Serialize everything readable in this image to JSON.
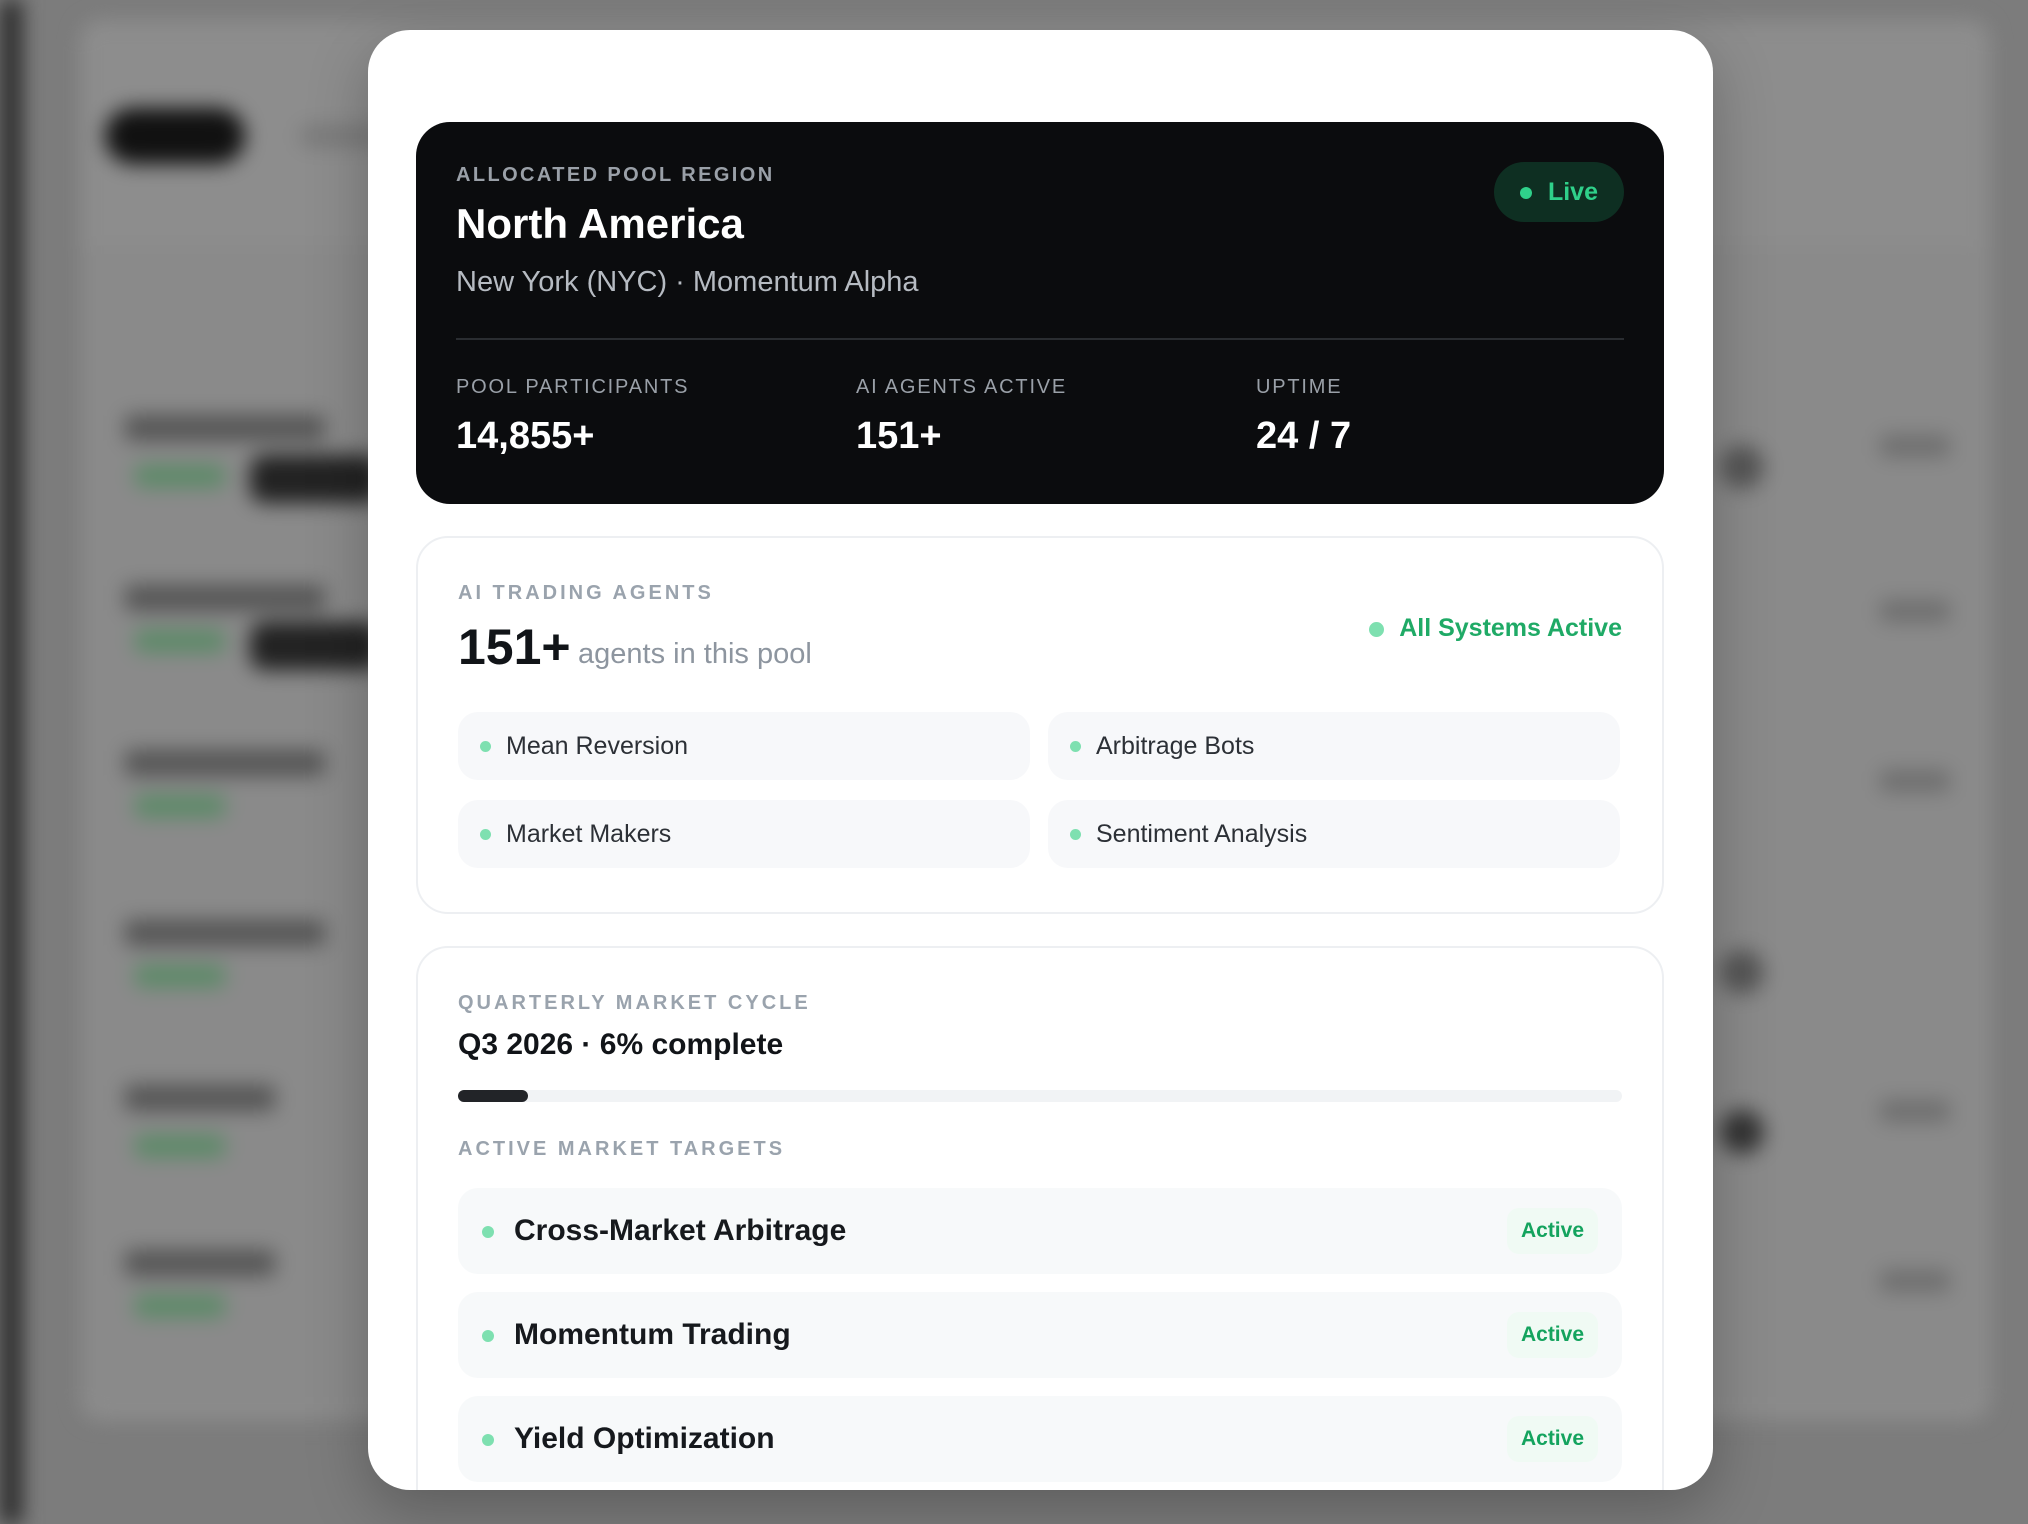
{
  "region": {
    "eyebrow": "ALLOCATED POOL REGION",
    "title": "North America",
    "subtitle": "New York (NYC) · Momentum Alpha",
    "live_label": "Live",
    "stats": [
      {
        "label": "POOL PARTICIPANTS",
        "value": "14,855+"
      },
      {
        "label": "AI AGENTS ACTIVE",
        "value": "151+"
      },
      {
        "label": "UPTIME",
        "value": "24 / 7"
      }
    ]
  },
  "agents": {
    "eyebrow": "AI TRADING AGENTS",
    "count": "151+",
    "count_suffix": "agents in this pool",
    "status": "All Systems Active",
    "types": [
      "Mean Reversion",
      "Arbitrage Bots",
      "Market Makers",
      "Sentiment Analysis"
    ]
  },
  "cycle": {
    "eyebrow": "QUARTERLY MARKET CYCLE",
    "title": "Q3 2026 · 6% complete",
    "progress_percent": 6,
    "targets_eyebrow": "ACTIVE MARKET TARGETS",
    "targets": [
      {
        "label": "Cross-Market Arbitrage",
        "status": "Active"
      },
      {
        "label": "Momentum Trading",
        "status": "Active"
      },
      {
        "label": "Yield Optimization",
        "status": "Active"
      }
    ]
  },
  "colors": {
    "accent_green": "#1faa66",
    "live_green": "#2fd08a",
    "dark_card": "#0b0c0e"
  }
}
